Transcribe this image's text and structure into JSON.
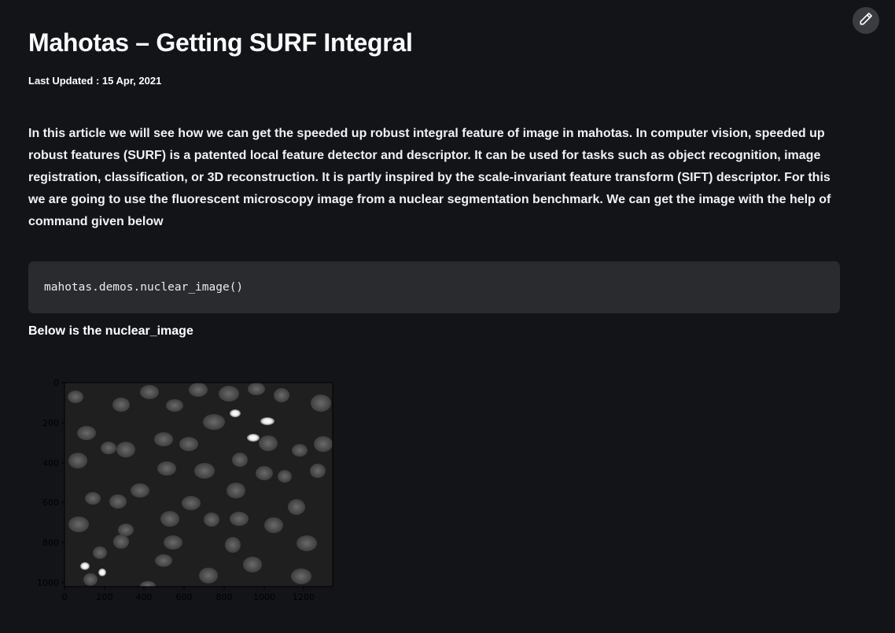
{
  "article": {
    "title": "Mahotas – Getting SURF Integral",
    "last_updated": "Last Updated : 15 Apr, 2021",
    "paragraph": "In this article we will see how we can get the speeded up robust integral feature of image in mahotas. In computer vision, speeded up robust features (SURF) is a patented local feature detector and descriptor. It can be used for tasks such as object recognition, image registration, classification, or 3D reconstruction. It is partly inspired by the scale-invariant feature transform (SIFT) descriptor. For this we are going to use the fluorescent microscopy image from a nuclear segmentation benchmark. We can get the image with the help of command given below",
    "code": "mahotas.demos.nuclear_image()",
    "caption": "Below is the nuclear_image"
  },
  "toolbar": {
    "edit_icon": "pencil-icon"
  },
  "figure": {
    "y_ticks": [
      "0",
      "200",
      "400",
      "600",
      "800",
      "1000"
    ],
    "x_ticks": [
      "0",
      "200",
      "400",
      "600",
      "800",
      "1000",
      "1200"
    ]
  },
  "colors": {
    "background": "#131418",
    "code_background": "#2a2b2f",
    "edit_button": "#3b3c40"
  }
}
